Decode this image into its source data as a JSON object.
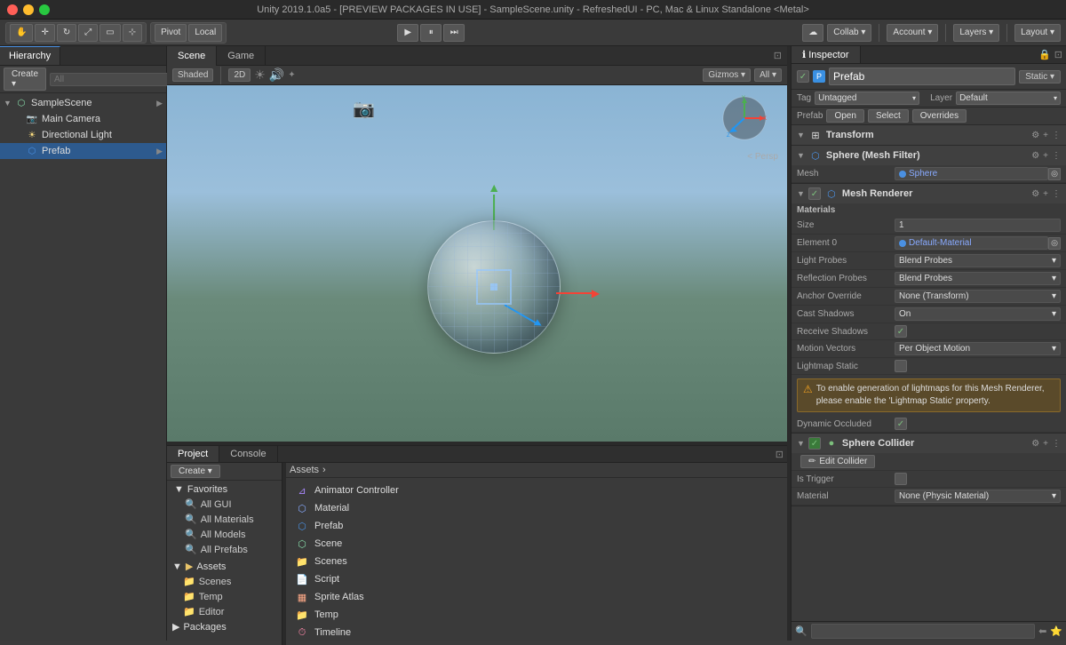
{
  "title": "Unity 2019.1.0a5 - [PREVIEW PACKAGES IN USE] - SampleScene.unity - RefreshedUI - PC, Mac & Linux Standalone <Metal>",
  "toolbar": {
    "pivot_label": "Pivot",
    "local_label": "Local",
    "scene_tab": "Scene",
    "game_tab": "Game",
    "collab_btn": "Collab ▾",
    "account_btn": "Account ▾",
    "layers_btn": "Layers ▾",
    "layout_btn": "Layout ▾",
    "shaded_label": "Shaded",
    "two_d_label": "2D",
    "gizmos_label": "Gizmos ▾",
    "all_label": "All ▾",
    "persp_label": "< Persp"
  },
  "hierarchy": {
    "tab": "Hierarchy",
    "create_btn": "Create ▾",
    "all_btn": "All",
    "scene_name": "SampleScene",
    "items": [
      {
        "label": "Main Camera",
        "icon": "📷",
        "indent": 1
      },
      {
        "label": "Directional Light",
        "icon": "☀",
        "indent": 1
      },
      {
        "label": "Prefab",
        "icon": "⬡",
        "indent": 1,
        "selected": true
      }
    ]
  },
  "inspector": {
    "tab": "Inspector",
    "tab_icon": "ℹ",
    "lock_icon": "🔒",
    "object_name": "Prefab",
    "static_label": "Static ▾",
    "tag_label": "Tag",
    "tag_value": "Untagged",
    "layer_label": "Layer",
    "layer_value": "Default",
    "prefab_label": "Prefab",
    "prefab_open": "Open",
    "prefab_select": "Select",
    "prefab_overrides": "Overrides",
    "components": [
      {
        "name": "Transform",
        "icon": "⊞",
        "enabled": null,
        "type": "transform"
      },
      {
        "name": "Sphere (Mesh Filter)",
        "icon": "⬡",
        "enabled": null,
        "type": "mesh-filter",
        "fields": [
          {
            "label": "Mesh",
            "value": "Sphere",
            "type": "obj"
          }
        ]
      },
      {
        "name": "Mesh Renderer",
        "icon": "⬡",
        "enabled": true,
        "type": "mesh-renderer",
        "fields": [
          {
            "label": "Materials",
            "value": "",
            "type": "section"
          },
          {
            "label": "Size",
            "value": "1",
            "type": "number"
          },
          {
            "label": "Element 0",
            "value": "Default-Material",
            "type": "obj"
          },
          {
            "label": "Light Probes",
            "value": "Blend Probes",
            "type": "dropdown"
          },
          {
            "label": "Reflection Probes",
            "value": "Blend Probes",
            "type": "dropdown"
          },
          {
            "label": "Anchor Override",
            "value": "None (Transform)",
            "type": "dropdown"
          },
          {
            "label": "Cast Shadows",
            "value": "On",
            "type": "dropdown"
          },
          {
            "label": "Receive Shadows",
            "value": "✓",
            "type": "check"
          },
          {
            "label": "Motion Vectors",
            "value": "Per Object Motion",
            "type": "dropdown"
          },
          {
            "label": "Lightmap Static",
            "value": "",
            "type": "check-empty"
          }
        ],
        "warning": "To enable generation of lightmaps for this Mesh Renderer, please enable the 'Lightmap Static' property.",
        "dynamic_occluded": true
      },
      {
        "name": "Sphere Collider",
        "icon": "●",
        "enabled": true,
        "type": "collider",
        "fields": [
          {
            "label": "Edit Collider",
            "value": "",
            "type": "action-btn"
          },
          {
            "label": "Is Trigger",
            "value": "",
            "type": "check-empty"
          },
          {
            "label": "Material",
            "value": "None (Physic Material)",
            "type": "dropdown"
          }
        ]
      }
    ]
  },
  "project": {
    "project_tab": "Project",
    "console_tab": "Console",
    "create_btn": "Create ▾",
    "favorites": {
      "header": "Favorites",
      "items": [
        "All GUI",
        "All Materials",
        "All Models",
        "All Prefabs"
      ]
    },
    "assets_tree": {
      "header": "Assets",
      "groups": [
        {
          "name": "Assets",
          "items": [
            {
              "label": "Scenes",
              "icon": "folder"
            },
            {
              "label": "Temp",
              "icon": "folder"
            },
            {
              "label": "Editor",
              "icon": "folder"
            }
          ]
        },
        {
          "name": "Packages",
          "items": []
        }
      ]
    },
    "assets_main": {
      "breadcrumb": "Assets",
      "items": [
        {
          "label": "Animator Controller",
          "icon": "anim"
        },
        {
          "label": "Material",
          "icon": "mat"
        },
        {
          "label": "Prefab",
          "icon": "prefab"
        },
        {
          "label": "Scene",
          "icon": "scene"
        },
        {
          "label": "Scenes",
          "icon": "folder"
        },
        {
          "label": "Script",
          "icon": "script"
        },
        {
          "label": "Sprite Atlas",
          "icon": "atlas"
        },
        {
          "label": "Temp",
          "icon": "folder"
        },
        {
          "label": "Timeline",
          "icon": "timeline"
        }
      ]
    }
  }
}
